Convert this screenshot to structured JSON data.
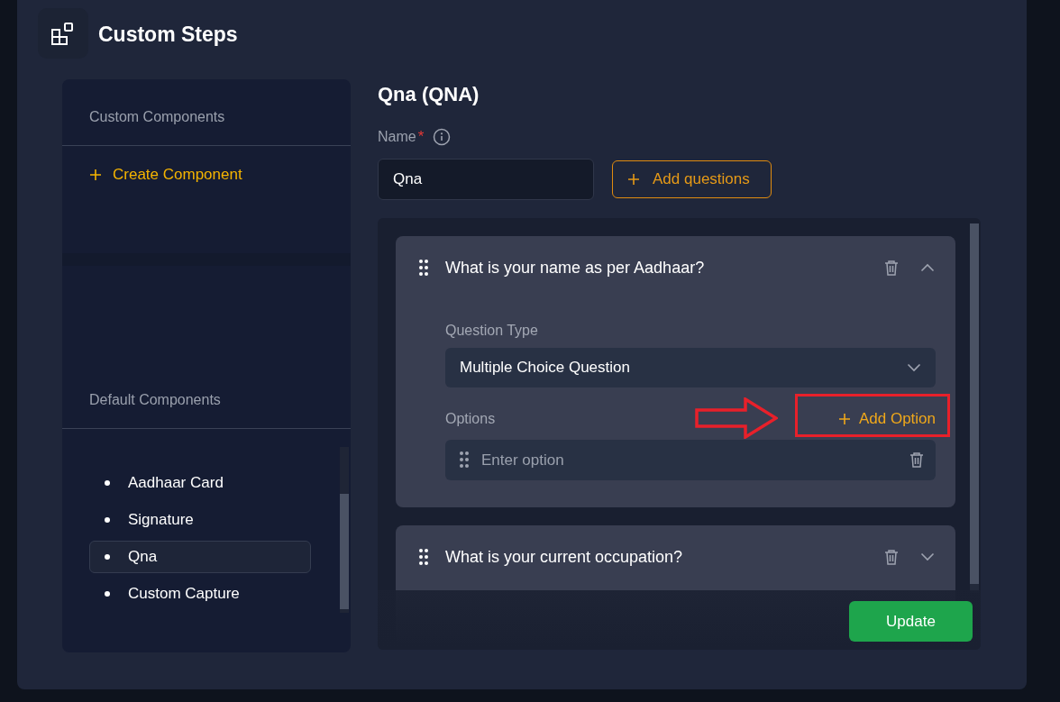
{
  "header": {
    "title": "Custom Steps"
  },
  "sidebar": {
    "custom_section": {
      "title": "Custom Components",
      "create_button": "Create Component"
    },
    "default_section": {
      "title": "Default Components",
      "items": [
        {
          "label": "Aadhaar Card",
          "selected": false
        },
        {
          "label": "Signature",
          "selected": false
        },
        {
          "label": "Qna",
          "selected": true
        },
        {
          "label": "Custom Capture",
          "selected": false
        }
      ]
    }
  },
  "editor": {
    "title": "Qna (QNA)",
    "name_field": {
      "label": "Name",
      "required_mark": "*",
      "value": "Qna"
    },
    "add_questions_button": "Add questions",
    "questions": [
      {
        "text": "What is your name as per Aadhaar?",
        "expanded": true,
        "question_type_label": "Question Type",
        "question_type": "Multiple Choice Question",
        "options_label": "Options",
        "add_option_button": "Add Option",
        "option_placeholder": "Enter option"
      },
      {
        "text": "What is your current occupation?",
        "expanded": false
      }
    ],
    "update_button": "Update"
  }
}
